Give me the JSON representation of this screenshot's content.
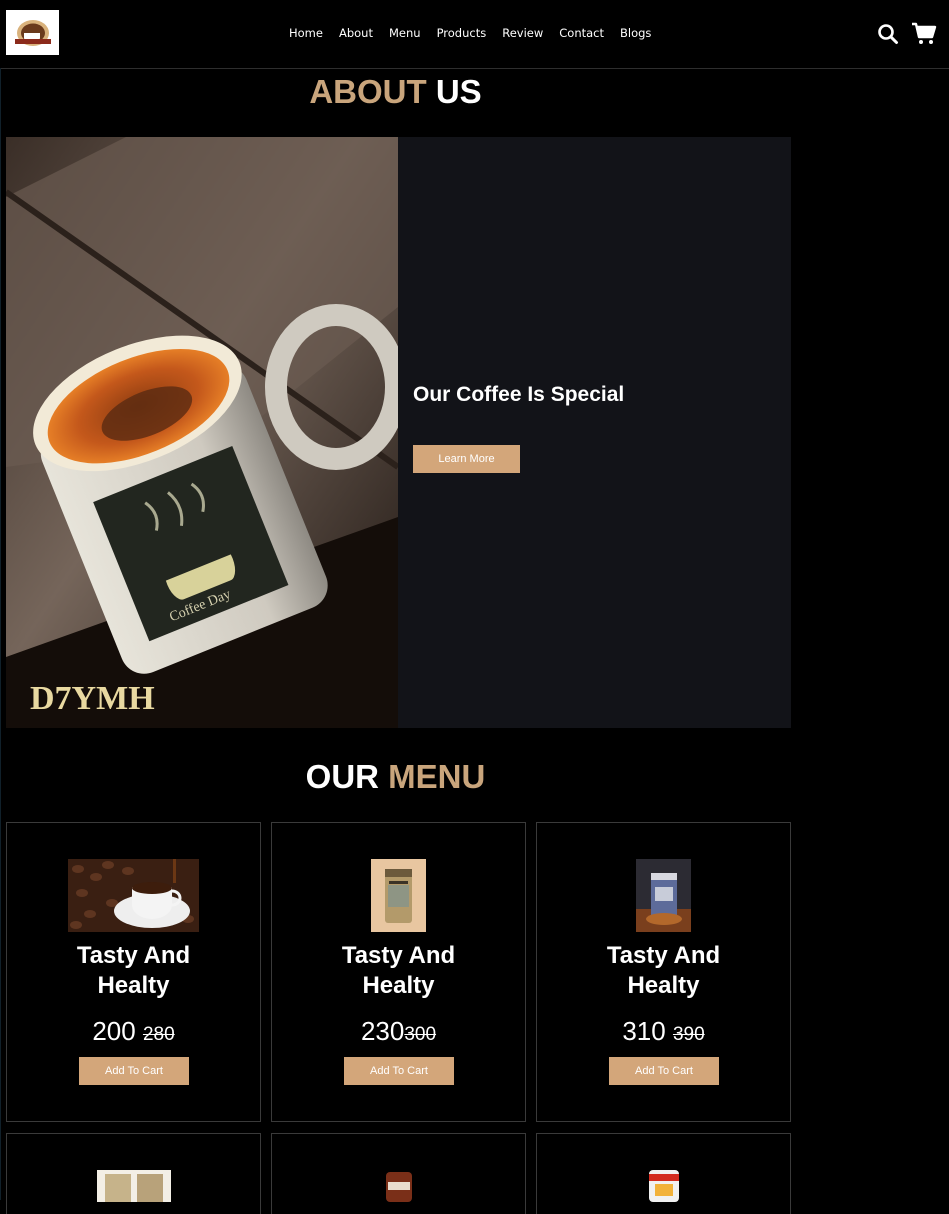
{
  "nav": {
    "items": [
      "Home",
      "About",
      "Menu",
      "Products",
      "Review",
      "Contact",
      "Blogs"
    ]
  },
  "header": {
    "icons": [
      "search-icon",
      "cart-icon"
    ]
  },
  "about": {
    "title_accent": "ABOUT",
    "title_rest": "US",
    "heading": "Our Coffee Is Special",
    "button_label": "Learn More",
    "image_watermark": "D7YMH"
  },
  "menu": {
    "title_rest": "OUR",
    "title_accent": "MENU",
    "items": [
      {
        "title_line1": "Tasty And",
        "title_line2": "Healty",
        "price": "200",
        "old_price": "280",
        "button": "Add To Cart"
      },
      {
        "title_line1": "Tasty And",
        "title_line2": "Healty",
        "price": "230",
        "old_price": "300",
        "button": "Add To Cart"
      },
      {
        "title_line1": "Tasty And",
        "title_line2": "Healty",
        "price": "310",
        "old_price": "390",
        "button": "Add To Cart"
      }
    ]
  },
  "colors": {
    "accent": "#c9a57c",
    "button": "#d3a67a",
    "panel": "#121318"
  }
}
